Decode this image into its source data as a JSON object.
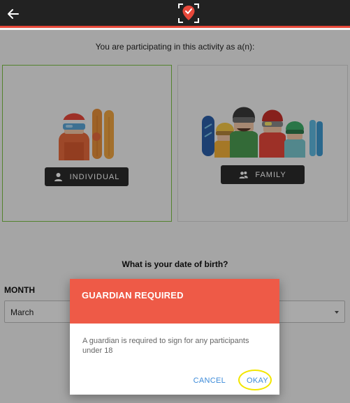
{
  "header": {
    "back_icon": "arrow-left-icon",
    "logo_icon": "location-pin-logo-icon",
    "accent_color": "#e8483a"
  },
  "prompt": "You are participating in this activity as a(n):",
  "options": {
    "individual": {
      "label": "INDIVIDUAL",
      "icon": "person-icon",
      "illustration": "single-skier"
    },
    "family": {
      "label": "FAMILY",
      "icon": "group-icon",
      "illustration": "family-skiers"
    }
  },
  "dob": {
    "question": "What is your date of birth?",
    "month_label": "MONTH",
    "month_value": "March"
  },
  "modal": {
    "title": "GUARDIAN REQUIRED",
    "body": "A guardian is required to sign for any participants under 18",
    "cancel": "CANCEL",
    "okay": "OKAY",
    "header_color": "#ee5a47",
    "link_color": "#3c8bd9"
  }
}
